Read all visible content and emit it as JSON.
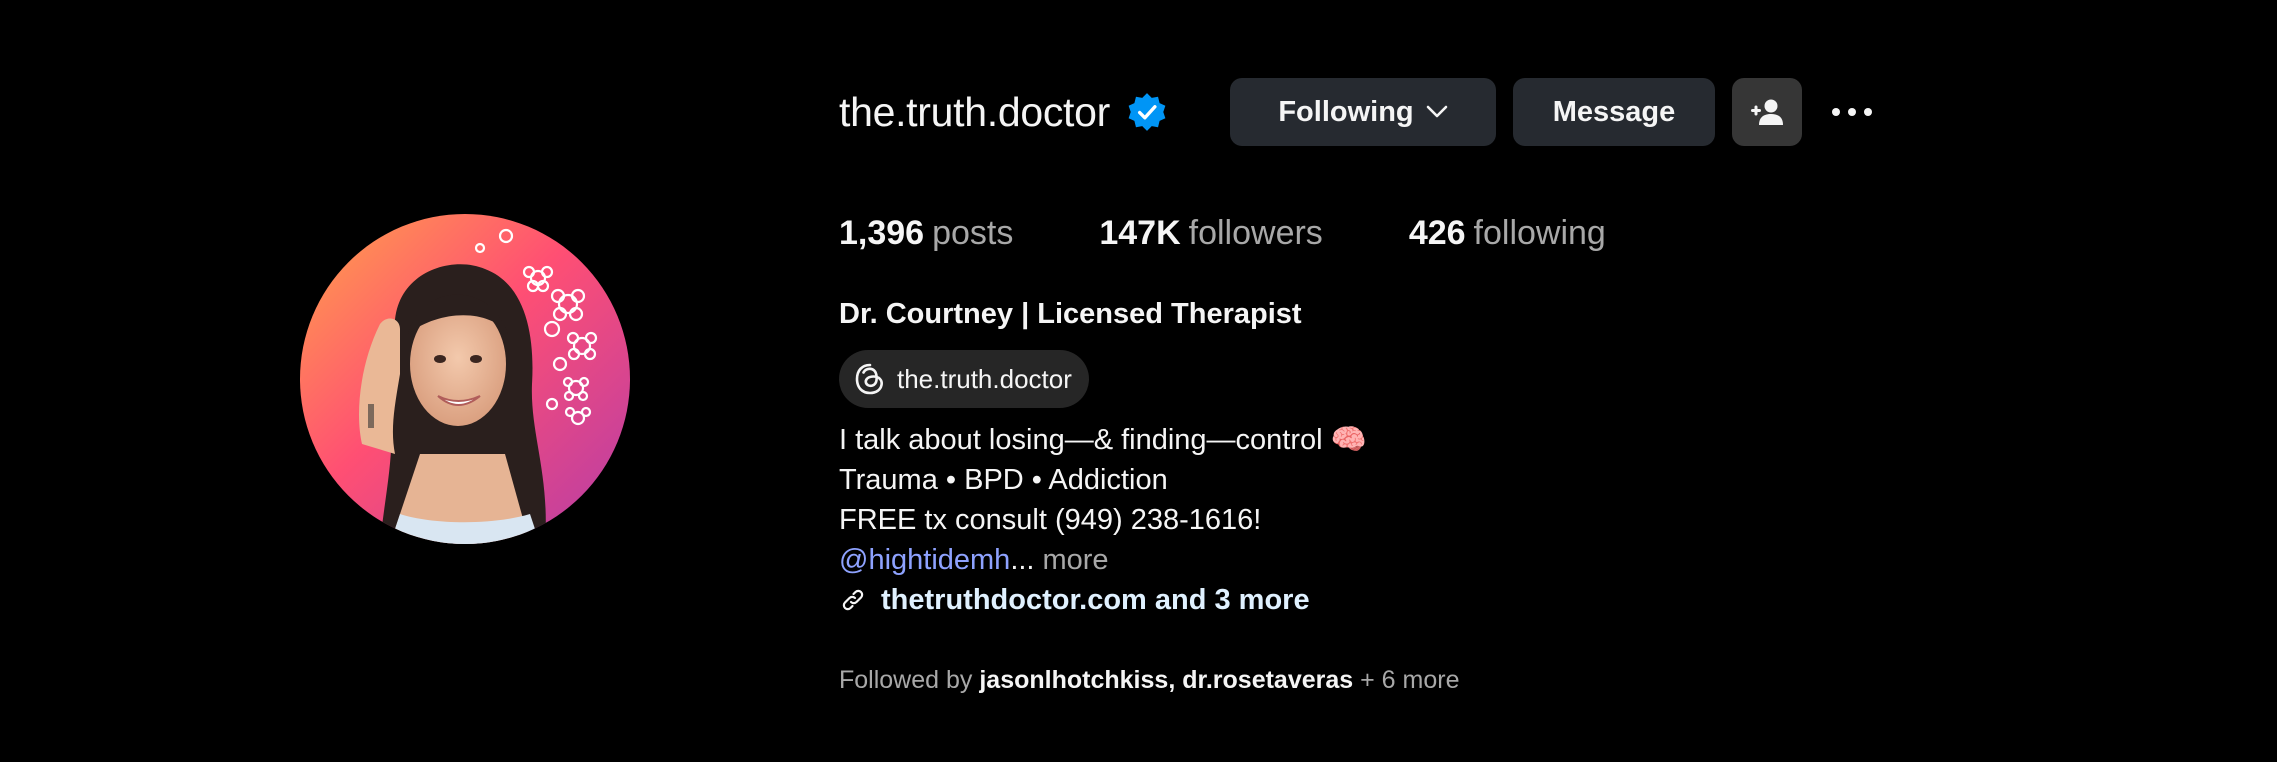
{
  "profile": {
    "username": "the.truth.doctor",
    "verified": true,
    "avatar_alt": "profile picture"
  },
  "actions": {
    "following_label": "Following",
    "message_label": "Message",
    "add_user_icon": "person-plus-icon",
    "more_icon": "ellipsis-icon"
  },
  "stats": {
    "posts_count": "1,396",
    "posts_label": "posts",
    "followers_count": "147K",
    "followers_label": "followers",
    "following_count": "426",
    "following_label": "following"
  },
  "bio": {
    "full_name": "Dr. Courtney | Licensed Therapist",
    "threads_handle": "the.truth.doctor",
    "line1": "I talk about losing—& finding—control 🧠",
    "line2": "Trauma • BPD • Addiction",
    "line3": "FREE tx consult (949) 238-1616!",
    "mention": "@hightidemh",
    "ellipsis": "...",
    "more_label": "more",
    "link_text": "thetruthdoctor.com and 3 more"
  },
  "followed_by": {
    "prefix": "Followed by",
    "user1": "jasonlhotchkiss",
    "separator": ",",
    "user2": "dr.rosetaveras",
    "extra": "+ 6 more"
  },
  "colors": {
    "background": "#000000",
    "button": "#262a30",
    "mention": "#8ea2ff",
    "verified_blue": "#0095f6",
    "muted": "#a8a8a8"
  }
}
